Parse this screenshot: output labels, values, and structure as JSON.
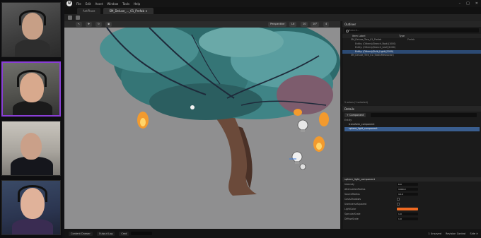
{
  "app": {
    "menu": [
      "File",
      "Edit",
      "Asset",
      "Window",
      "Tools",
      "Help"
    ],
    "tabs": [
      {
        "label": "AntPlace",
        "active": false
      },
      {
        "label": "SM_Deluxe_..._01_Prefab ×",
        "active": true
      }
    ],
    "logo_letter": "U"
  },
  "viewport_bar": {
    "perspective_label": "Perspective",
    "lit_label": "Lit",
    "grid_value": "10",
    "angle_value": "10°",
    "scale_value": "0.25",
    "speed_value": "4"
  },
  "outliner": {
    "title": "Outliner",
    "search_placeholder": "Search...",
    "columns": {
      "label": "Item Label",
      "type": "Type"
    },
    "rows": [
      {
        "label": "SM_Deluxe_Tree_01_Prefab",
        "type": "Prefab",
        "selected": false
      },
      {
        "label": "Entity: (Others)(Branch_Root)(1000)",
        "type": "",
        "selected": false
      },
      {
        "label": "Entity: (Others)(Branch_Leaf)(1000)",
        "type": "",
        "selected": false
      },
      {
        "label": "Entity: (Others)(Bulb_Light)(1000)",
        "type": "",
        "selected": true
      },
      {
        "label": "SM_Deluxe_Tree_01 (StaticMeshActor)",
        "type": "",
        "selected": false
      }
    ],
    "footer": "5 actors (1 selected)"
  },
  "details": {
    "title": "Details",
    "add_button": "+ Component",
    "entity_label": "Entity",
    "components": [
      {
        "label": "transform_component",
        "selected": false
      },
      {
        "label": "sphere_light_component",
        "selected": true
      }
    ],
    "section_title": "sphere_light_component",
    "properties": [
      {
        "label": "Intensity",
        "value": "6.0",
        "kind": "number"
      },
      {
        "label": "AttenuationRadius",
        "value": "1000.0",
        "kind": "number"
      },
      {
        "label": "SourceRadius",
        "value": "10.0",
        "kind": "number"
      },
      {
        "label": "CastsShadows",
        "value": "",
        "kind": "checkbox"
      },
      {
        "label": "UseInverseSquared",
        "value": "",
        "kind": "checkbox"
      },
      {
        "label": "LightColor",
        "value": "#f06a22",
        "kind": "color"
      },
      {
        "label": "SpecularScale",
        "value": "1.0",
        "kind": "number"
      },
      {
        "label": "DiffuseScale",
        "value": "1.0",
        "kind": "number"
      }
    ]
  },
  "statusbar": {
    "content_drawer": "Content Drawer",
    "output_log": "Output Log",
    "cmd": "Cmd",
    "unsaved": "1 Unsaved",
    "revision": "Revision Control",
    "extra": "Side ✕"
  },
  "colors": {
    "accent": "#8a3fd6",
    "selection": "#2c4a73",
    "viewport_bg": "#8f8f90",
    "leaf_dark": "#2d6a6b",
    "leaf_light": "#6aa9a8",
    "trunk": "#6b4a3a",
    "flame": "#f29a2e"
  }
}
